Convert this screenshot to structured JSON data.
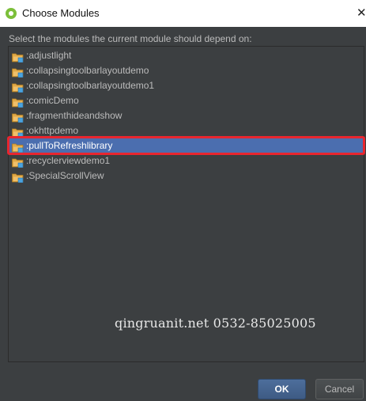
{
  "window": {
    "title": "Choose Modules",
    "close_glyph": "✕",
    "app_icon": "android-studio-icon"
  },
  "prompt": "Select the modules the current module should depend on:",
  "modules": [
    {
      "label": ":adjustlight",
      "icon": "module-folder-icon",
      "selected": false
    },
    {
      "label": ":collapsingtoolbarlayoutdemo",
      "icon": "module-folder-icon",
      "selected": false
    },
    {
      "label": ":collapsingtoolbarlayoutdemo1",
      "icon": "module-folder-icon",
      "selected": false
    },
    {
      "label": ":comicDemo",
      "icon": "module-folder-icon",
      "selected": false
    },
    {
      "label": ":fragmenthideandshow",
      "icon": "module-folder-icon",
      "selected": false
    },
    {
      "label": ":okhttpdemo",
      "icon": "module-folder-icon",
      "selected": false
    },
    {
      "label": ":pullToRefreshlibrary",
      "icon": "module-folder-icon",
      "selected": true
    },
    {
      "label": ":recyclerviewdemo1",
      "icon": "module-folder-icon",
      "selected": false
    },
    {
      "label": ":SpecialScrollView",
      "icon": "module-folder-icon",
      "selected": false
    }
  ],
  "watermark": "qingruanit.net 0532-85025005",
  "buttons": {
    "ok": "OK",
    "cancel": "Cancel"
  },
  "colors": {
    "selection": "#4b6eaf",
    "annotation_box": "#e8262f",
    "folder": "#e0a846",
    "module_badge": "#4aa3df"
  }
}
